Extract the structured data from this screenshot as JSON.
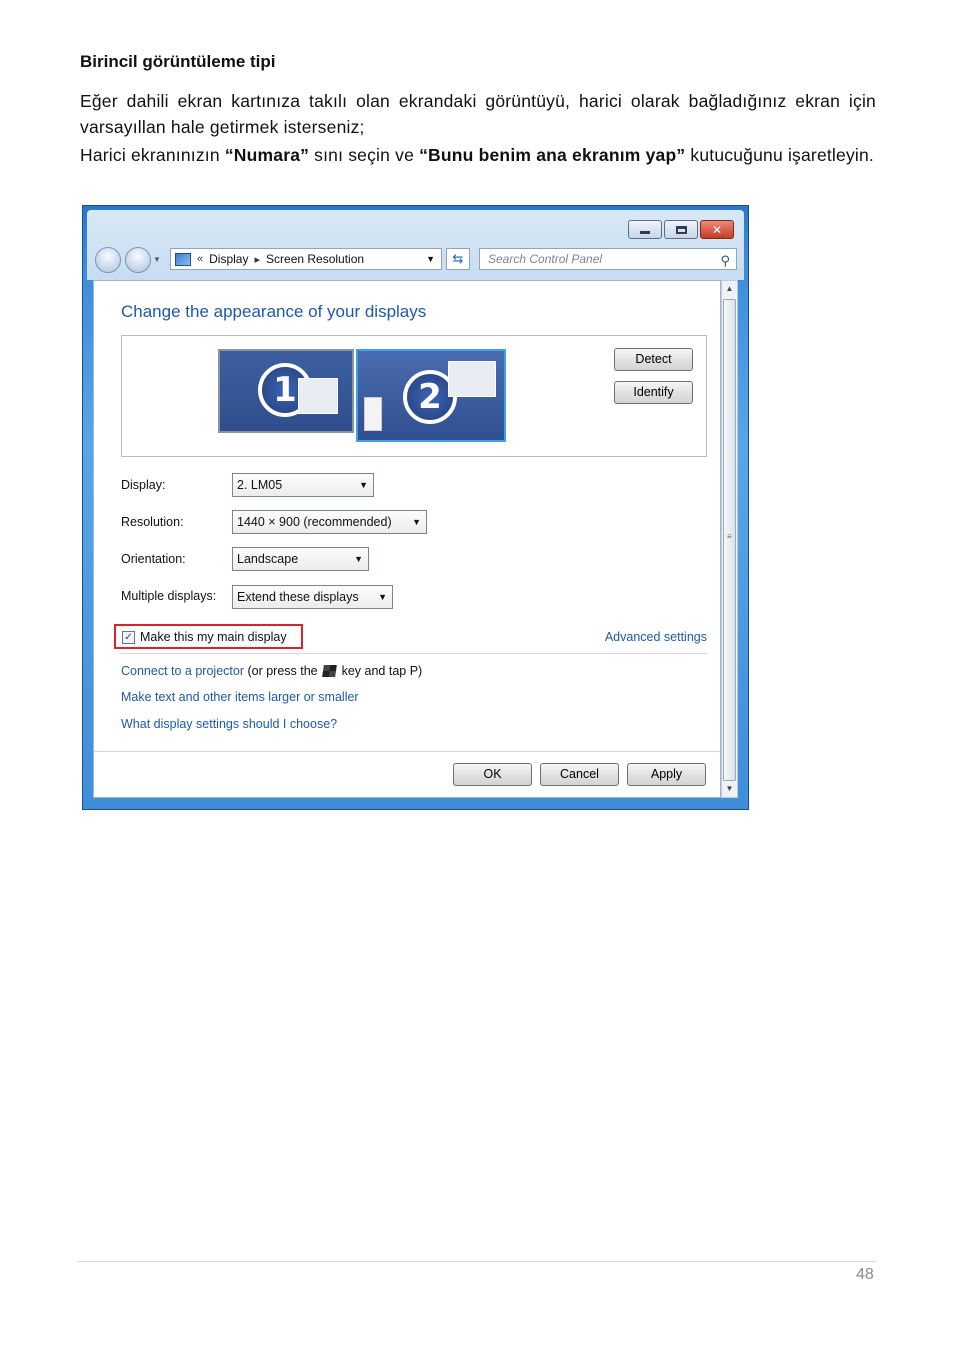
{
  "doc": {
    "heading": "Birincil görüntüleme tipi",
    "para1": "Eğer dahili ekran kartınıza takılı olan ekrandaki görüntüyü, harici olarak bağladığınız ekran için varsayıllan hale getirmek isterseniz;",
    "para2_pre": "Harici ekranınızın ",
    "para2_b1": "“Numara”",
    "para2_mid": " sını seçin ve ",
    "para2_b2": "“Bunu benim ana ekranım yap”",
    "para2_post": " kutucuğunu işaretleyin."
  },
  "window": {
    "address": {
      "chevron": "«",
      "crumb1": "Display",
      "sep": "▸",
      "crumb2": "Screen Resolution"
    },
    "search_placeholder": "Search Control Panel",
    "title": "Change the appearance of your displays",
    "monitors": {
      "m1": "1",
      "m2": "2"
    },
    "buttons": {
      "detect": "Detect",
      "identify": "Identify",
      "ok": "OK",
      "cancel": "Cancel",
      "apply": "Apply"
    },
    "fields": {
      "display_label": "Display:",
      "display_value": "2. LM05",
      "resolution_label": "Resolution:",
      "resolution_value": "1440 × 900 (recommended)",
      "orientation_label": "Orientation:",
      "orientation_value": "Landscape",
      "multiple_label": "Multiple displays:",
      "multiple_value": "Extend these displays"
    },
    "main_display_label": "Make this my main display",
    "main_display_checked": true,
    "advanced_link": "Advanced settings",
    "links": {
      "projector": "Connect to a projector",
      "projector_hint_a": " (or press the ",
      "projector_hint_b": " key and tap P)",
      "text_size": "Make text and other items larger or smaller",
      "which_settings": "What display settings should I choose?"
    }
  },
  "page_number": "48"
}
